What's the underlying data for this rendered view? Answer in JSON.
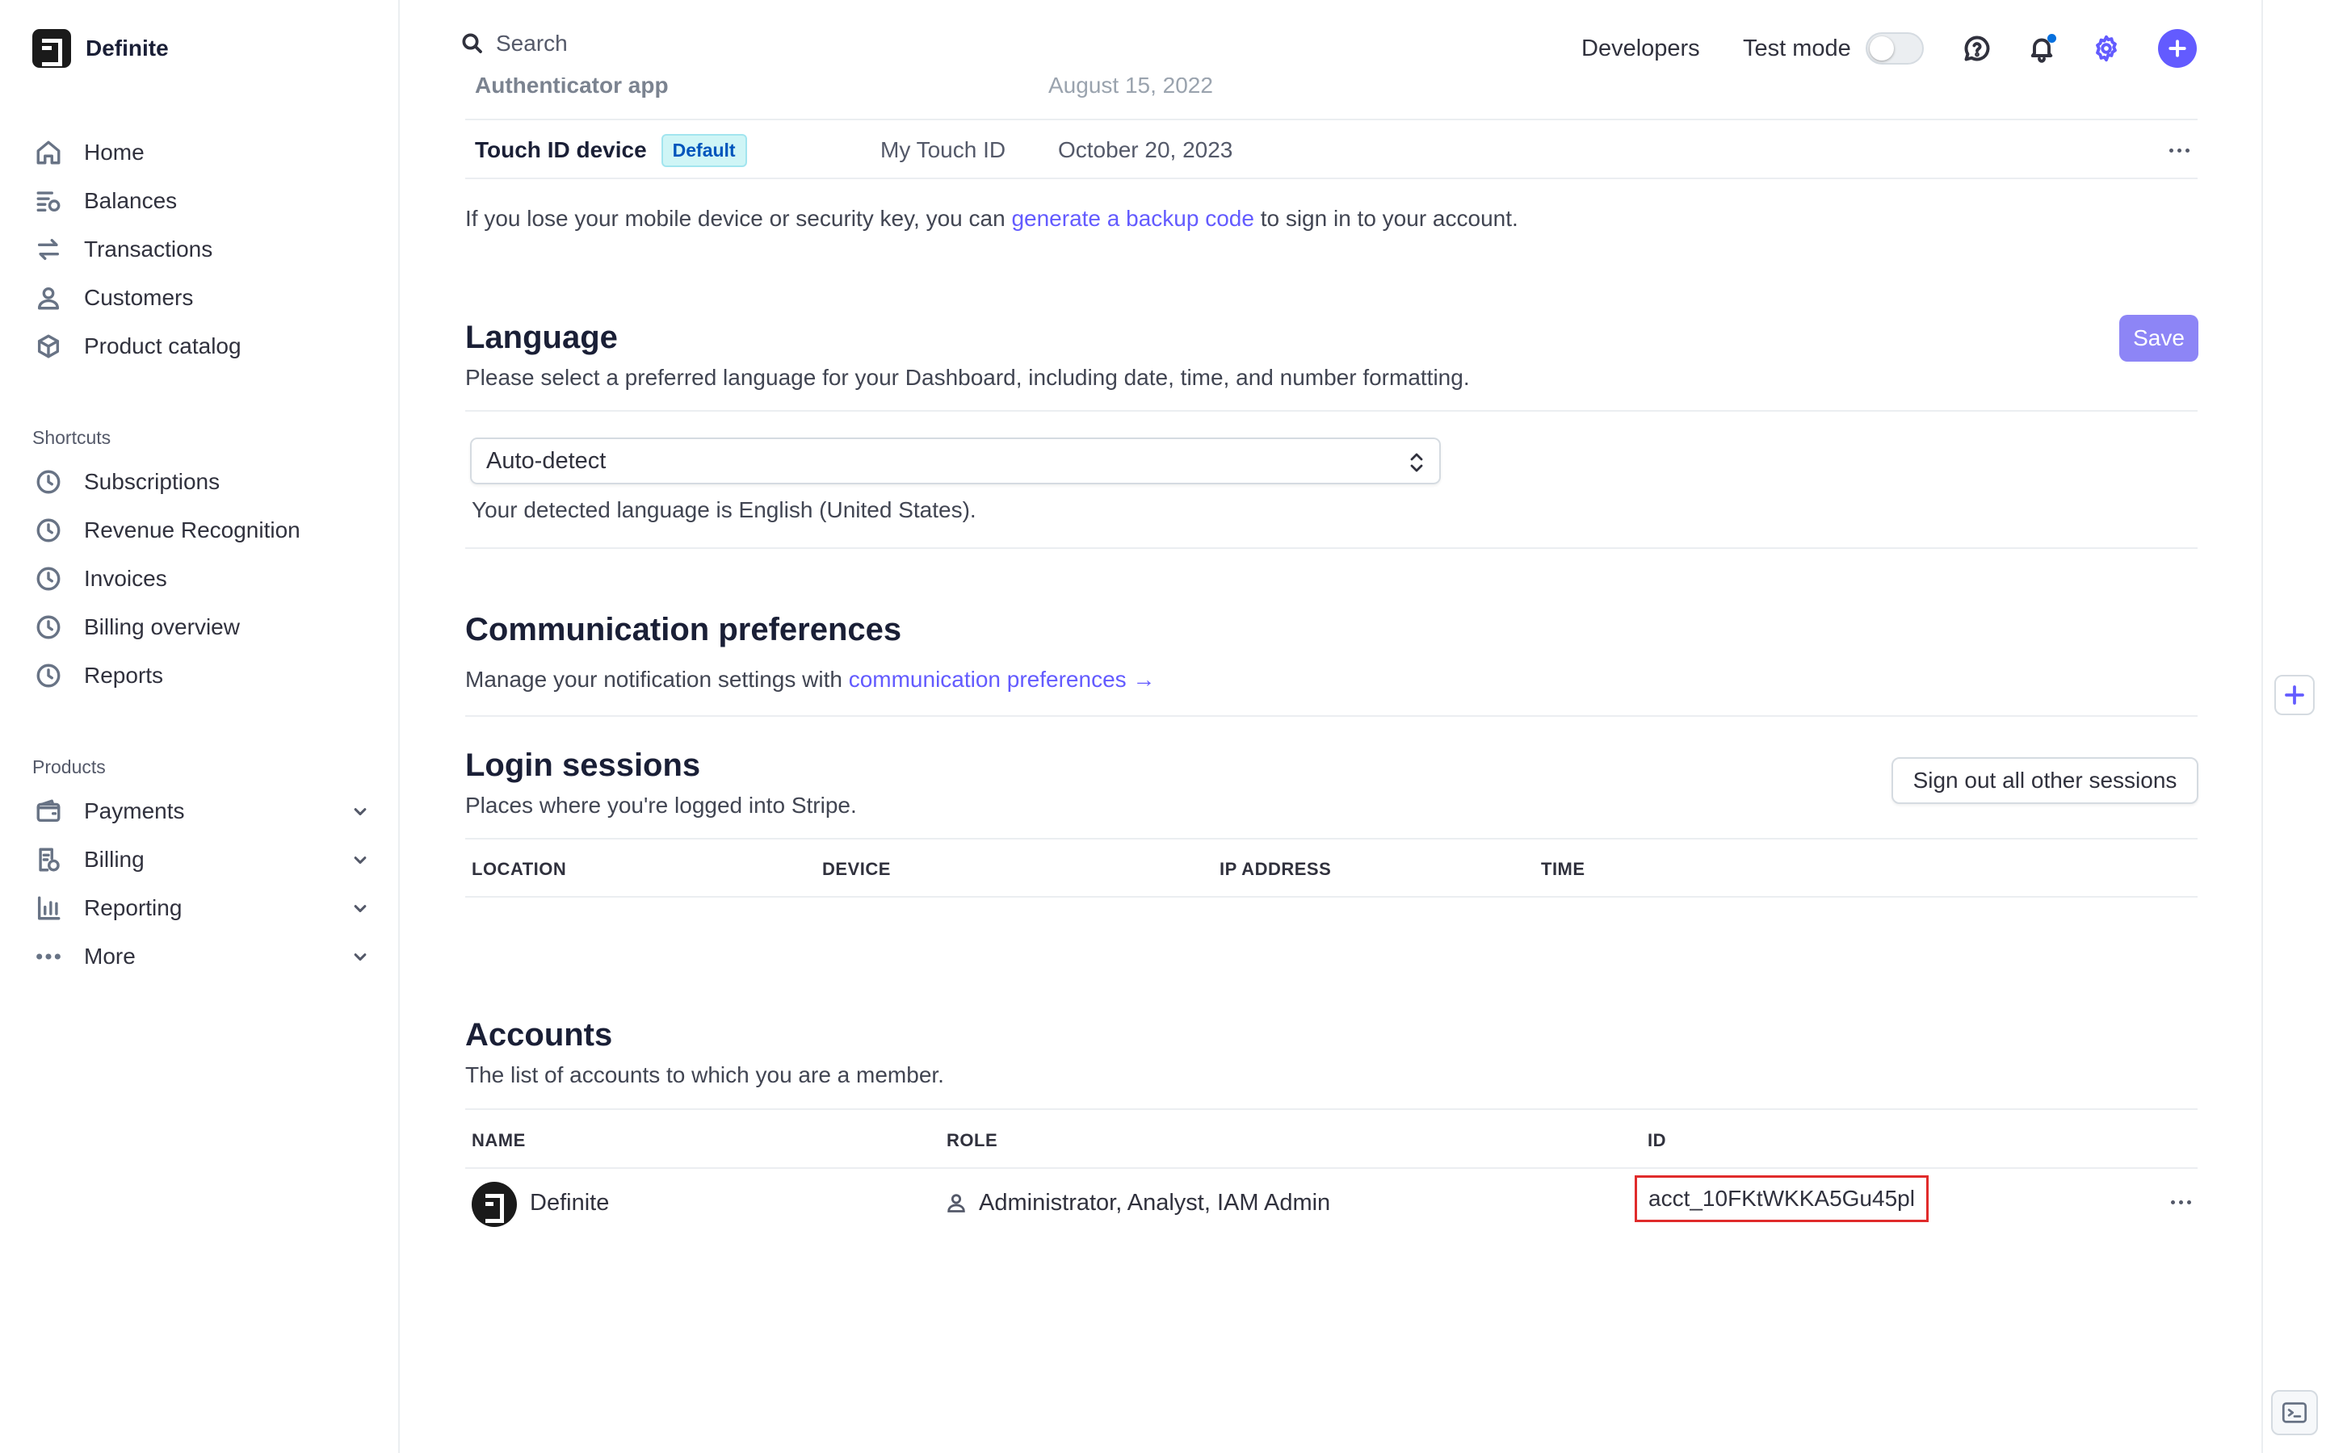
{
  "app": {
    "name": "Definite"
  },
  "sidebar": {
    "main_items": [
      {
        "label": "Home",
        "icon": "home-icon"
      },
      {
        "label": "Balances",
        "icon": "balances-icon"
      },
      {
        "label": "Transactions",
        "icon": "transactions-icon"
      },
      {
        "label": "Customers",
        "icon": "customers-icon"
      },
      {
        "label": "Product catalog",
        "icon": "product-catalog-icon"
      }
    ],
    "shortcuts_label": "Shortcuts",
    "shortcuts": [
      {
        "label": "Subscriptions",
        "icon": "clock-icon"
      },
      {
        "label": "Revenue Recognition",
        "icon": "clock-icon"
      },
      {
        "label": "Invoices",
        "icon": "clock-icon"
      },
      {
        "label": "Billing overview",
        "icon": "clock-icon"
      },
      {
        "label": "Reports",
        "icon": "clock-icon"
      }
    ],
    "products_label": "Products",
    "products": [
      {
        "label": "Payments",
        "icon": "wallet-icon"
      },
      {
        "label": "Billing",
        "icon": "billing-icon"
      },
      {
        "label": "Reporting",
        "icon": "bar-chart-icon"
      },
      {
        "label": "More",
        "icon": "more-dots-icon"
      }
    ]
  },
  "topbar": {
    "search_placeholder": "Search",
    "developers": "Developers",
    "test_mode": "Test mode",
    "test_mode_on": false
  },
  "security": {
    "faded_row": "Authenticator app",
    "faded_date": "August 15, 2022",
    "touch_id": {
      "name": "Touch ID device",
      "badge": "Default",
      "device": "My Touch ID",
      "date": "October 20, 2023"
    },
    "backup_pre": "If you lose your mobile device or security key, you can ",
    "backup_link": "generate a backup code",
    "backup_post": " to sign in to your account."
  },
  "language": {
    "title": "Language",
    "description": "Please select a preferred language for your Dashboard, including date, time, and number formatting.",
    "save": "Save",
    "selected": "Auto-detect",
    "detected": "Your detected language is English (United States)."
  },
  "communication": {
    "title": "Communication preferences",
    "text": "Manage your notification settings with ",
    "link": "communication preferences →"
  },
  "sessions": {
    "title": "Login sessions",
    "description": "Places where you're logged into Stripe.",
    "sign_out": "Sign out all other sessions",
    "columns": [
      "LOCATION",
      "DEVICE",
      "IP ADDRESS",
      "TIME"
    ]
  },
  "accounts": {
    "title": "Accounts",
    "description": "The list of accounts to which you are a member.",
    "columns": [
      "NAME",
      "ROLE",
      "ID"
    ],
    "rows": [
      {
        "name": "Definite",
        "role": "Administrator, Analyst, IAM Admin",
        "id": "acct_10FKtWKKA5Gu45pl"
      }
    ]
  },
  "colors": {
    "accent": "#635bff",
    "highlight": "#e02b2b",
    "badge_bg": "#cff5f6"
  }
}
